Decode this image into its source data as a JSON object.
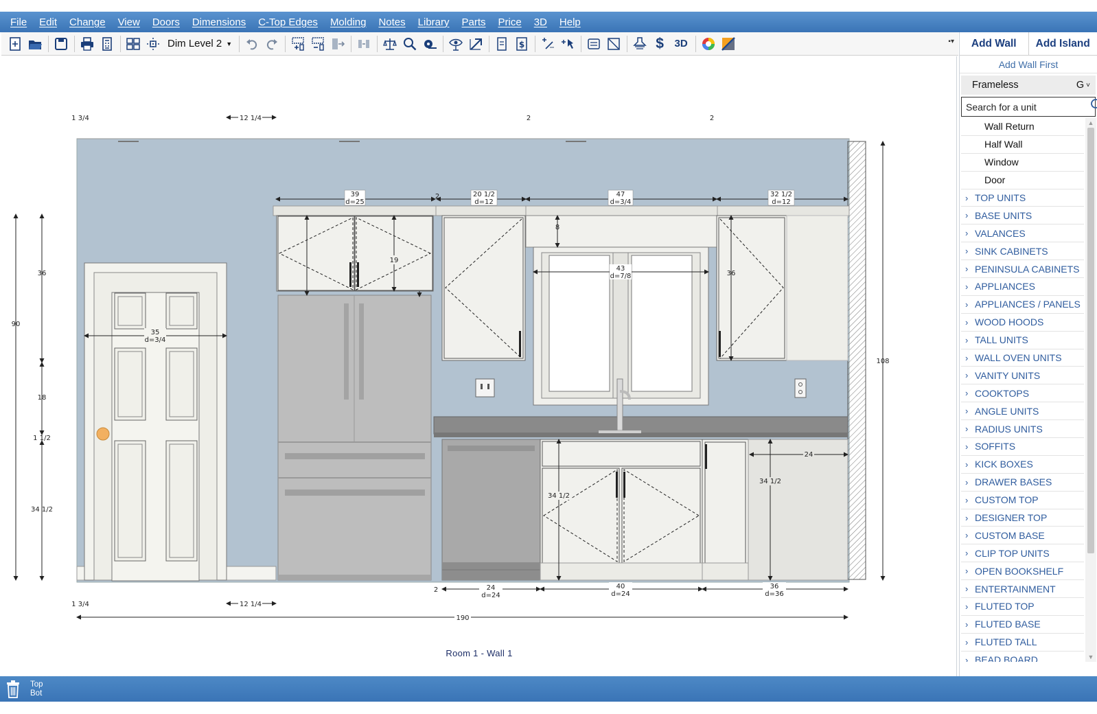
{
  "menu": [
    "File",
    "Edit",
    "Change",
    "View",
    "Doors",
    "Dimensions",
    "C-Top Edges",
    "Molding",
    "Notes",
    "Library",
    "Parts",
    "Price",
    "3D",
    "Help"
  ],
  "toolbar": {
    "dim_level": "Dim Level 2",
    "three_d_label": "3D",
    "price_label": "$",
    "icons": [
      "new-page-icon",
      "open-folder-icon",
      "save-icon",
      "print-icon",
      "calculator-icon",
      "layout-grid-icon",
      "move-center-icon",
      "undo-icon",
      "redo-icon",
      "add-column-icon",
      "remove-column-icon",
      "shift-right-icon",
      "align-icon",
      "scale-icon",
      "zoom-icon",
      "tape-measure-icon",
      "eye-icon",
      "arrow-icon",
      "report-icon",
      "invoice-icon",
      "dimension-tool-icon",
      "insert-point-icon",
      "panel-icon",
      "slash-box-icon",
      "hood-icon",
      "color-wheel-icon",
      "palette-icon"
    ]
  },
  "panel": {
    "tabs": [
      "Add Wall",
      "Add Island"
    ],
    "add_wall_first": "Add Wall First",
    "construction": "Frameless",
    "construction_code": "G",
    "search_placeholder": "Search for a unit",
    "items": [
      {
        "label": "Wall Return",
        "kind": "plain"
      },
      {
        "label": "Half Wall",
        "kind": "plain"
      },
      {
        "label": "Window",
        "kind": "plain"
      },
      {
        "label": "Door",
        "kind": "plain"
      },
      {
        "label": "TOP UNITS",
        "kind": "category"
      },
      {
        "label": "BASE UNITS",
        "kind": "category"
      },
      {
        "label": "VALANCES",
        "kind": "category"
      },
      {
        "label": "SINK CABINETS",
        "kind": "category"
      },
      {
        "label": "PENINSULA CABINETS",
        "kind": "category"
      },
      {
        "label": "APPLIANCES",
        "kind": "category"
      },
      {
        "label": "APPLIANCES / PANELS",
        "kind": "category"
      },
      {
        "label": "WOOD HOODS",
        "kind": "category"
      },
      {
        "label": "TALL UNITS",
        "kind": "category"
      },
      {
        "label": "WALL OVEN UNITS",
        "kind": "category"
      },
      {
        "label": "VANITY UNITS",
        "kind": "category"
      },
      {
        "label": "COOKTOPS",
        "kind": "category"
      },
      {
        "label": "ANGLE UNITS",
        "kind": "category"
      },
      {
        "label": "RADIUS UNITS",
        "kind": "category"
      },
      {
        "label": "SOFFITS",
        "kind": "category"
      },
      {
        "label": "KICK BOXES",
        "kind": "category"
      },
      {
        "label": "DRAWER BASES",
        "kind": "category"
      },
      {
        "label": "CUSTOM TOP",
        "kind": "category"
      },
      {
        "label": "DESIGNER TOP",
        "kind": "category"
      },
      {
        "label": "CUSTOM BASE",
        "kind": "category"
      },
      {
        "label": "CLIP TOP UNITS",
        "kind": "category"
      },
      {
        "label": "OPEN BOOKSHELF",
        "kind": "category"
      },
      {
        "label": "ENTERTAINMENT",
        "kind": "category"
      },
      {
        "label": "FLUTED TOP",
        "kind": "category"
      },
      {
        "label": "FLUTED BASE",
        "kind": "category"
      },
      {
        "label": "FLUTED TALL",
        "kind": "category"
      },
      {
        "label": "BEAD BOARD",
        "kind": "category"
      }
    ]
  },
  "drawing": {
    "caption": "Room 1  -  Wall 1",
    "dims": {
      "top_left": "1 3/4",
      "top_gap": "12 1/4",
      "top_mark_a": "2",
      "top_mark_b": "2",
      "uc1_width": "39",
      "uc1_depth": "d=25",
      "uc_gap": "2",
      "uc2_width": "20 1/2",
      "uc2_depth": "d=12",
      "window_span": "47",
      "window_span_depth": "d=3/4",
      "uc3_width": "32 1/2",
      "uc3_depth": "d=12",
      "valance_h": "8",
      "fridge_top_h": "19",
      "window_w": "43",
      "window_d": "d=7/8",
      "uc3_h": "36",
      "door_w": "35",
      "door_d": "d=3/4",
      "left_36": "36",
      "left_90": "90",
      "left_18": "18",
      "left_112": "1 1/2",
      "left_3412": "34 1/2",
      "right_108": "108",
      "base_h_sink": "34 1/2",
      "base_h_right": "34 1/2",
      "counter_ext": "24",
      "bot_left": "1 3/4",
      "bot_gap": "12 1/4",
      "bot_mark": "2",
      "dw_w": "24",
      "dw_d": "d=24",
      "sink_w": "40",
      "sink_d": "d=24",
      "right_base_w": "36",
      "right_base_d": "d=36",
      "overall": "190"
    }
  },
  "status": {
    "top": "Top",
    "bot": "Bot"
  },
  "colors": {
    "menubar": "#3a74b6",
    "wall_paint": "#b2c2d0",
    "cabinet": "#f1f1ed",
    "fridge": "#bdbdbd",
    "counter": "#8a8a8a",
    "link_blue": "#2f5c9e",
    "knob": "#f2b060"
  }
}
